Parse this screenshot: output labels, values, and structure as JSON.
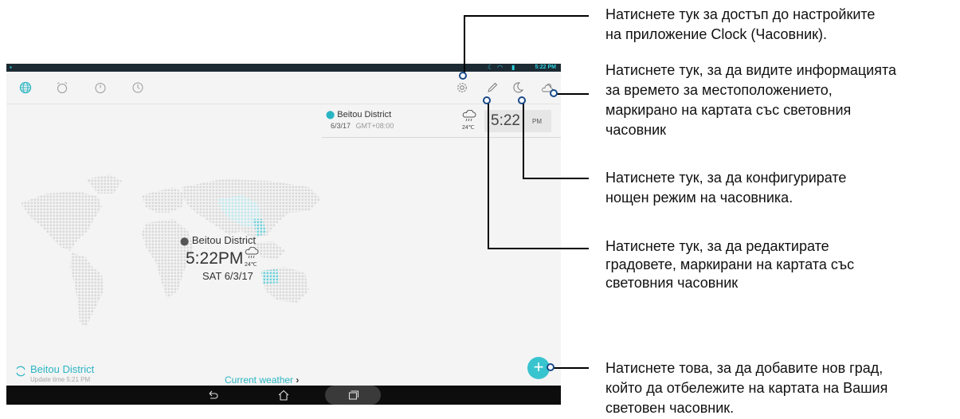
{
  "status_bar": {
    "time": "5:22 PM"
  },
  "toolbar": {
    "tabs": [
      "world-clock",
      "alarm",
      "stopwatch",
      "timer"
    ],
    "actions": [
      "settings",
      "edit",
      "night-mode",
      "weather"
    ]
  },
  "city_card": {
    "city": "Beitou District",
    "date": "6/3/17",
    "gmt": "GMT+08:00",
    "temp": "24℃",
    "time": "5:22",
    "ampm": "PM"
  },
  "map_label": {
    "city": "Beitou District",
    "time": "5:22PM",
    "temp": "24℃",
    "date": "SAT 6/3/17"
  },
  "bottom": {
    "city": "Beitou District",
    "update": "Update time 5:21 PM",
    "current_weather": "Current weather"
  },
  "fab_label": "+",
  "callouts": {
    "settings": "Натиснете тук за достъп до настройките\nна приложение Clock (Часовник).",
    "weather": "Натиснете тук, за да видите информацията\nза времето за местоположението,\nмаркирано на картата със световния\nчасовник",
    "night": "Натиснете тук, за да конфигурирате\nнощен режим на часовника.",
    "edit": "Натиснете тук, за да редактирате\nградовете, маркирани на картата със\nсветовния часовник",
    "add": "Натиснете това, за да добавите нов град,\nкойто да отбележите на картата на Вашия\nсветовен часовник."
  },
  "colors": {
    "accent": "#2bb5c3",
    "statusbar": "#1c2a33",
    "navbar": "#0d0d0d",
    "callout_dot": "#1a4a8a"
  }
}
